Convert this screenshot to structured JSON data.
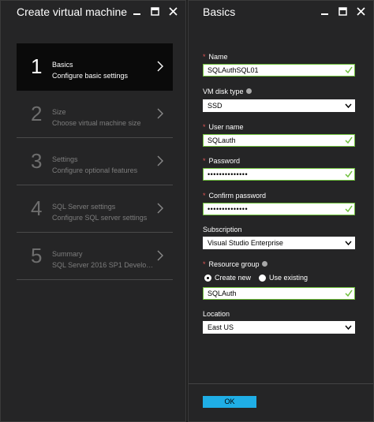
{
  "left_blade": {
    "title": "Create virtual machine",
    "steps": [
      {
        "number": "1",
        "title": "Basics",
        "subtitle": "Configure basic settings",
        "active": true
      },
      {
        "number": "2",
        "title": "Size",
        "subtitle": "Choose virtual machine size",
        "active": false
      },
      {
        "number": "3",
        "title": "Settings",
        "subtitle": "Configure optional features",
        "active": false
      },
      {
        "number": "4",
        "title": "SQL Server settings",
        "subtitle": "Configure SQL server settings",
        "active": false
      },
      {
        "number": "5",
        "title": "Summary",
        "subtitle": "SQL Server 2016 SP1 Develope...",
        "active": false
      }
    ]
  },
  "right_blade": {
    "title": "Basics",
    "fields": {
      "name": {
        "label": "Name",
        "value": "SQLAuthSQL01",
        "required": true
      },
      "vm_disk_type": {
        "label": "VM disk type",
        "value": "SSD"
      },
      "user_name": {
        "label": "User name",
        "value": "SQLauth",
        "required": true
      },
      "password": {
        "label": "Password",
        "value": "••••••••••••••",
        "required": true
      },
      "confirm_password": {
        "label": "Confirm password",
        "value": "••••••••••••••",
        "required": true
      },
      "subscription": {
        "label": "Subscription",
        "value": "Visual Studio Enterprise"
      },
      "resource_group": {
        "label": "Resource group",
        "required": true,
        "options": [
          "Create new",
          "Use existing"
        ],
        "selected": "Create new",
        "value": "SQLAuth"
      },
      "location": {
        "label": "Location",
        "value": "East US"
      }
    },
    "ok_label": "OK"
  },
  "colors": {
    "background": "#252526",
    "active_step": "#0a0a0a",
    "required_asterisk": "#e05555",
    "valid_check": "#6ebf3a",
    "ok_button": "#1faee6"
  },
  "icons": [
    "minimize-icon",
    "maximize-icon",
    "close-icon",
    "chevron-right-icon",
    "checkmark-icon",
    "dropdown-caret-icon",
    "info-icon"
  ]
}
